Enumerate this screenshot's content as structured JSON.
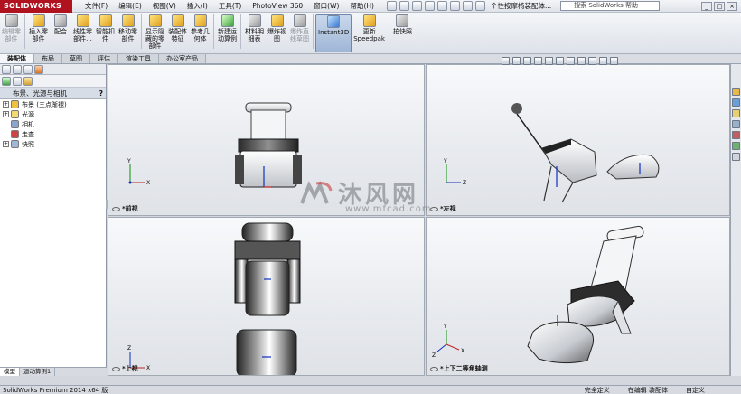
{
  "app": {
    "logo": "SOLIDWORKS",
    "title": "个性按摩椅装配体...",
    "help_search_placeholder": "搜索 SolidWorks 帮助"
  },
  "menus": [
    "文件(F)",
    "编辑(E)",
    "视图(V)",
    "插入(I)",
    "工具(T)",
    "PhotoView 360",
    "窗口(W)",
    "帮助(H)"
  ],
  "window_buttons": [
    "_",
    "□",
    "×"
  ],
  "commands": [
    {
      "label": "编辑零\n部件",
      "icon": "edit-component-icon",
      "color": "gray",
      "dim": true
    },
    {
      "label": "插入零\n部件",
      "icon": "insert-component-icon",
      "color": "yellow"
    },
    {
      "label": "配合",
      "icon": "mate-icon",
      "color": "gray"
    },
    {
      "label": "线性零\n部件...",
      "icon": "linear-pattern-icon",
      "color": "yellow"
    },
    {
      "label": "智能扣\n件",
      "icon": "smart-fastener-icon",
      "color": "yellow"
    },
    {
      "label": "移动零\n部件",
      "icon": "move-component-icon",
      "color": "yellow"
    },
    {
      "label": "显示隐\n藏的零\n部件",
      "icon": "show-hidden-icon",
      "color": "yellow"
    },
    {
      "label": "装配体\n特征",
      "icon": "assembly-feature-icon",
      "color": "yellow"
    },
    {
      "label": "参考几\n何体",
      "icon": "reference-geometry-icon",
      "color": "yellow"
    },
    {
      "label": "新建运\n动算例",
      "icon": "motion-study-icon",
      "color": "green"
    },
    {
      "label": "材料明\n细表",
      "icon": "bom-icon",
      "color": "gray"
    },
    {
      "label": "爆炸视\n图",
      "icon": "exploded-view-icon",
      "color": "yellow"
    },
    {
      "label": "爆炸直\n线草图",
      "icon": "explode-line-icon",
      "color": "gray",
      "dim": true
    },
    {
      "label": "Instant3D",
      "icon": "instant3d-icon",
      "color": "blue",
      "active": true
    },
    {
      "label": "更新\nSpeedpak",
      "icon": "speedpak-icon",
      "color": "yellow"
    },
    {
      "label": "拍快照",
      "icon": "snapshot-icon",
      "color": "gray"
    }
  ],
  "tabs": [
    {
      "label": "装配体",
      "active": true
    },
    {
      "label": "布局"
    },
    {
      "label": "草图"
    },
    {
      "label": "评估"
    },
    {
      "label": "渲染工具"
    },
    {
      "label": "办公室产品"
    }
  ],
  "left_panel": {
    "title": "布景、光源与相机",
    "help": "?",
    "tree": [
      {
        "label": "布景 (三点渐褪)",
        "icon": "scene-icon",
        "expandable": true,
        "color": "#f0c040"
      },
      {
        "label": "光源",
        "icon": "light-icon",
        "expandable": true,
        "color": "#f4d870"
      },
      {
        "label": "相机",
        "icon": "camera-icon",
        "expandable": false,
        "color": "#8aa6cc"
      },
      {
        "label": "走查",
        "icon": "walkthrough-icon",
        "expandable": false,
        "color": "#cc4444"
      },
      {
        "label": "快照",
        "icon": "snapshot-folder-icon",
        "expandable": true,
        "color": "#a0b8d8"
      }
    ],
    "bottom_tabs": [
      {
        "label": "模型",
        "active": true
      },
      {
        "label": "运动算例1"
      }
    ]
  },
  "viewports": {
    "front": "*前视",
    "left": "*左视",
    "top": "*上视",
    "iso": "*上下二等角轴测"
  },
  "axes": {
    "x": "X",
    "y": "Y",
    "z": "Z"
  },
  "watermark": {
    "text": "沐风网",
    "url": "www.mfcad.com"
  },
  "status": {
    "left": "SolidWorks Premium 2014 x64 版",
    "items": [
      "完全定义",
      "在编辑 装配体",
      "自定义"
    ]
  }
}
